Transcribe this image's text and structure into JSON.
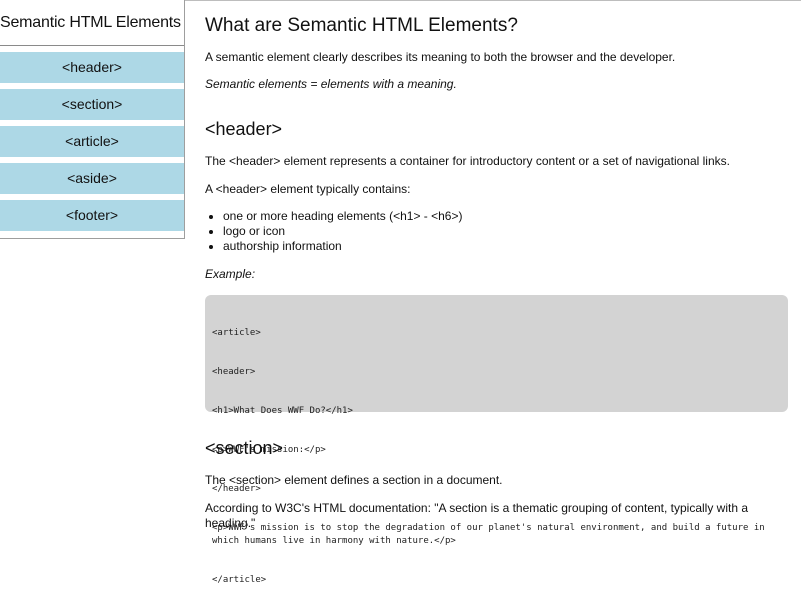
{
  "sidebar": {
    "title": "Semantic HTML Elements",
    "items": [
      {
        "label": "<header>"
      },
      {
        "label": "<section>"
      },
      {
        "label": "<article>"
      },
      {
        "label": "<aside>"
      },
      {
        "label": "<footer>"
      }
    ]
  },
  "main": {
    "title": "What are Semantic HTML Elements?",
    "intro": "A semantic element clearly describes its meaning to both the browser and the developer.",
    "intro_italic": "Semantic elements = elements with a meaning.",
    "header_section": {
      "heading": "<header>",
      "p1": "The <header> element represents a container for introductory content or a set of navigational links.",
      "p2": "A <header> element typically contains:",
      "list": [
        "one or more heading elements (<h1> - <h6>)",
        "logo or icon",
        "authorship information"
      ],
      "example_label": "Example:",
      "code_lines": [
        "<article>",
        "<header>",
        "<h1>What Does WWF Do?</h1>",
        "<p>WWF's mission:</p>",
        "</header>",
        "<p>WWF's mission is to stop the degradation of our planet's natural environment, and build a future in which humans live in harmony with nature.</p>",
        "</article>"
      ]
    },
    "section_section": {
      "heading": "<section>",
      "p1": "The <section> element defines a section in a document.",
      "p2": "According to W3C's HTML documentation: \"A section is a thematic grouping of content, typically with a heading.\""
    }
  },
  "colors": {
    "sidebar_item_bg": "#add8e6",
    "code_bg": "#d3d3d3"
  }
}
